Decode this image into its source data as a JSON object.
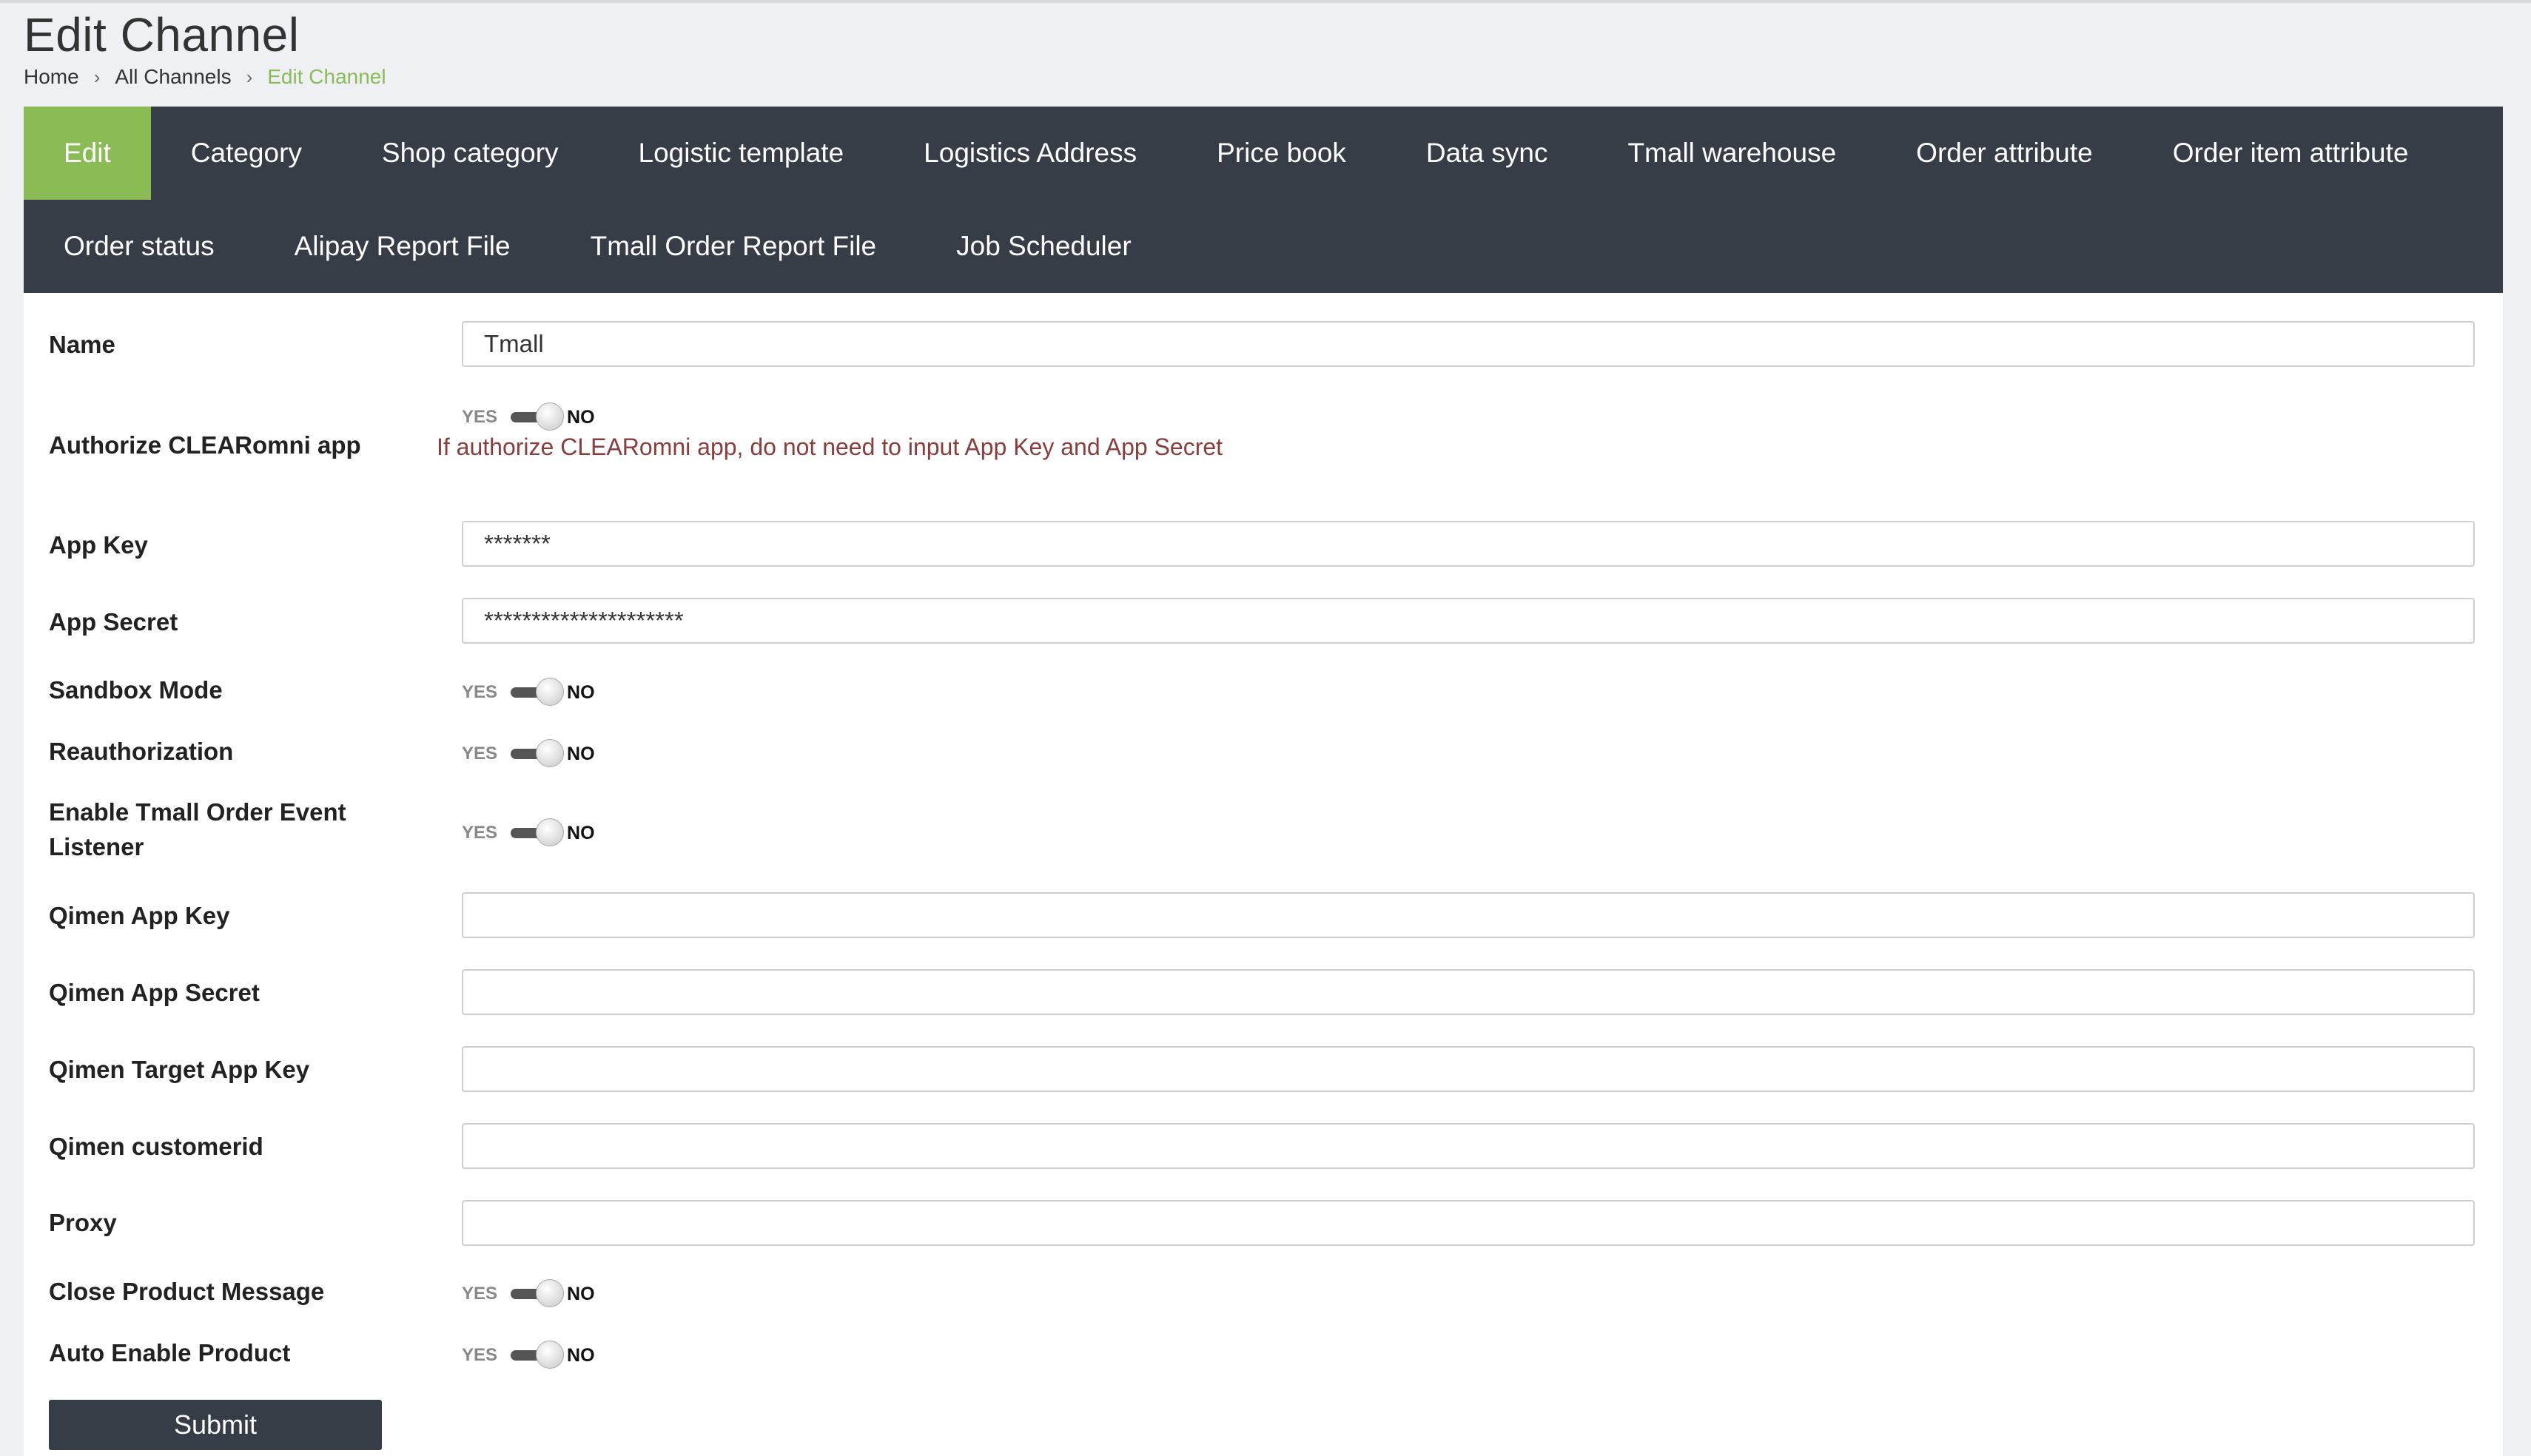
{
  "page": {
    "title": "Edit Channel"
  },
  "breadcrumb": {
    "home": "Home",
    "all_channels": "All Channels",
    "current": "Edit Channel",
    "separator": "›"
  },
  "tabs": {
    "row1": [
      "Edit",
      "Category",
      "Shop category",
      "Logistic template",
      "Logistics Address",
      "Price book",
      "Data sync",
      "Tmall warehouse",
      "Order attribute",
      "Order item attribute"
    ],
    "row2": [
      "Order status",
      "Alipay Report File",
      "Tmall Order Report File",
      "Job Scheduler"
    ],
    "active": "Edit"
  },
  "form": {
    "name": {
      "label": "Name",
      "value": "Tmall"
    },
    "authorize": {
      "label": "Authorize CLEARomni app",
      "yes": "YES",
      "no": "NO",
      "state": "NO",
      "hint": "If authorize CLEARomni app, do not need to input App Key and App Secret"
    },
    "app_key": {
      "label": "App Key",
      "value": "*******"
    },
    "app_secret": {
      "label": "App Secret",
      "value": "*********************"
    },
    "sandbox": {
      "label": "Sandbox Mode",
      "yes": "YES",
      "no": "NO",
      "state": "NO"
    },
    "reauth": {
      "label": "Reauthorization",
      "yes": "YES",
      "no": "NO",
      "state": "NO"
    },
    "event_listener": {
      "label_line1": "Enable Tmall Order Event",
      "label_line2": "Listener",
      "yes": "YES",
      "no": "NO",
      "state": "NO"
    },
    "qimen_app_key": {
      "label": "Qimen App Key",
      "value": ""
    },
    "qimen_app_secret": {
      "label": "Qimen App Secret",
      "value": ""
    },
    "qimen_target_app_key": {
      "label": "Qimen Target App Key",
      "value": ""
    },
    "qimen_customerid": {
      "label": "Qimen customerid",
      "value": ""
    },
    "proxy": {
      "label": "Proxy",
      "value": ""
    },
    "close_product_message": {
      "label": "Close Product Message",
      "yes": "YES",
      "no": "NO",
      "state": "NO"
    },
    "auto_enable_product": {
      "label": "Auto Enable Product",
      "yes": "YES",
      "no": "NO",
      "state": "NO"
    },
    "submit_label": "Submit"
  },
  "colors": {
    "accent": "#8bbb55",
    "nav_bg": "#373d47",
    "hint": "#8a3d3d",
    "page_bg": "#eef0f4"
  }
}
